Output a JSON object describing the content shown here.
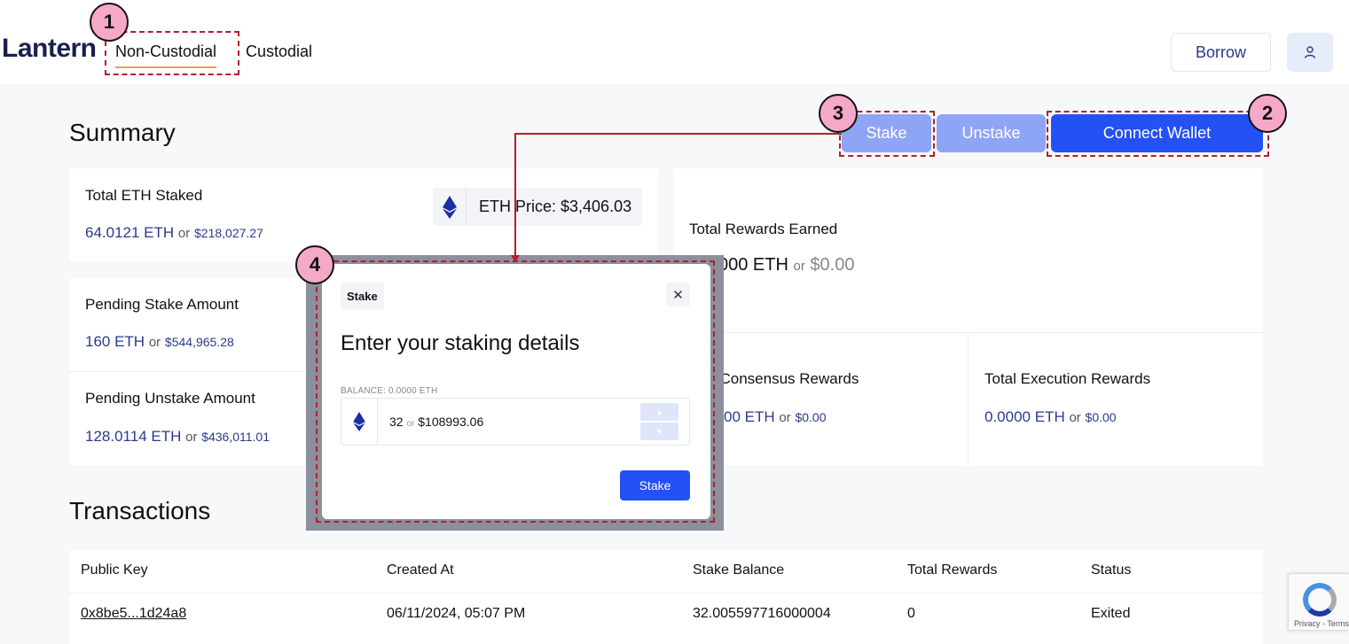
{
  "header": {
    "logo": "Lantern",
    "tabs": [
      {
        "label": "Non-Custodial",
        "active": true
      },
      {
        "label": "Custodial",
        "active": false
      }
    ],
    "borrow_label": "Borrow",
    "user_icon": "user-icon"
  },
  "summary": {
    "title": "Summary",
    "buttons": {
      "stake": "Stake",
      "unstake": "Unstake",
      "connect": "Connect Wallet"
    },
    "total_staked": {
      "label": "Total ETH Staked",
      "eth": "64.0121 ETH",
      "or": "or",
      "usd": "$218,027.27"
    },
    "eth_price": "ETH Price: $3,406.03",
    "pending_stake": {
      "label": "Pending Stake Amount",
      "eth": "160 ETH",
      "or": "or",
      "usd": "$544,965.28"
    },
    "pending_unstake": {
      "label": "Pending Unstake Amount",
      "eth": "128.0114 ETH",
      "or": "or",
      "usd": "$436,011.01"
    },
    "rewards": {
      "label": "Total Rewards Earned",
      "eth": "000 ETH",
      "or": "or",
      "usd": "$0.00"
    },
    "consensus": {
      "label": "l Consensus Rewards",
      "eth": "00 ETH",
      "or": "or",
      "usd": "$0.00"
    },
    "execution": {
      "label": "Total Execution Rewards",
      "eth": "0.0000 ETH",
      "or": "or",
      "usd": "$0.00"
    }
  },
  "transactions": {
    "title": "Transactions",
    "columns": [
      "Public Key",
      "Created At",
      "Stake Balance",
      "Total Rewards",
      "Status"
    ],
    "rows": [
      [
        "0x8be5...1d24a8",
        "06/11/2024, 05:07 PM",
        "32.005597716000004",
        "0",
        "Exited"
      ]
    ]
  },
  "modal": {
    "tag": "Stake",
    "close_glyph": "✕",
    "heading": "Enter your staking details",
    "balance_label": "BALANCE: 0.0000 ETH",
    "amount": "32",
    "or": "or",
    "amount_usd": "$108993.06",
    "submit": "Stake"
  },
  "annotations": {
    "badges": [
      "1",
      "2",
      "3",
      "4"
    ],
    "color": "#b21f2d"
  },
  "recaptcha": {
    "terms": "Privacy - Terms"
  },
  "colors": {
    "brand": "#1a1f4e",
    "primary": "#2351f5",
    "primary_light": "#8ea4f5",
    "accent": "#f0a04b",
    "badge_fill": "#f6a8c8"
  }
}
